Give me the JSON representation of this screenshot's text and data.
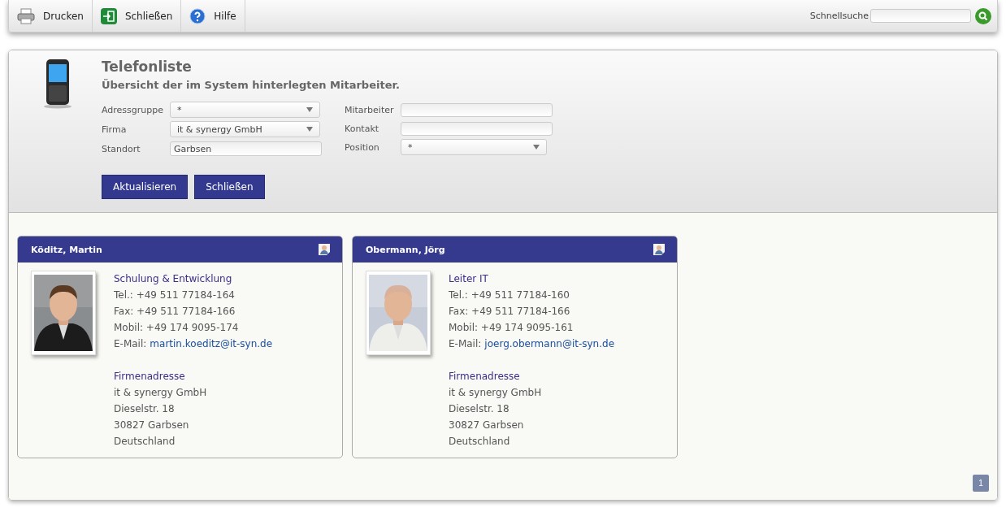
{
  "toolbar": {
    "buttons": [
      {
        "label": "Drucken",
        "kind": "print"
      },
      {
        "label": "Schließen",
        "kind": "close"
      },
      {
        "label": "Hilfe",
        "kind": "help"
      }
    ],
    "search": {
      "label": "Schnellsuche"
    }
  },
  "header": {
    "title": "Telefonliste",
    "subtitle": "Übersicht der im System hinterlegten Mitarbeiter.",
    "columns": [
      [
        {
          "label": "Adressgruppe",
          "kind": "select",
          "value": "*"
        },
        {
          "label": "Firma",
          "kind": "select",
          "value": "it & synergy GmbH"
        },
        {
          "label": "Standort",
          "kind": "input",
          "value": "Garbsen"
        }
      ],
      [
        {
          "label": "Mitarbeiter",
          "kind": "input"
        },
        {
          "label": "Kontakt",
          "kind": "input"
        },
        {
          "label": "Position",
          "kind": "select",
          "value": "*"
        }
      ]
    ],
    "buttons": [
      "Aktualisieren",
      "Schließen"
    ]
  },
  "cards": [
    {
      "name": "Köditz, Martin",
      "position": "Schulung & Entwicklung",
      "phones": [
        "Tel.: +49 511 77184-164",
        "Fax: +49 511 77184-166",
        "Mobil: +49 174 9095-174"
      ],
      "email_label": "E-Mail:",
      "email": "martin.koeditz@it-syn.de",
      "address_title": "Firmenadresse",
      "address": [
        "it & synergy GmbH",
        "Dieselstr. 18",
        "30827 Garbsen",
        "Deutschland"
      ]
    },
    {
      "name": "Obermann, Jörg",
      "position": "Leiter IT",
      "phones": [
        "Tel.: +49 511 77184-160",
        "Fax: +49 511 77184-166",
        "Mobil: +49 174 9095-161"
      ],
      "email_label": "E-Mail:",
      "email": "joerg.obermann@it-syn.de",
      "address_title": "Firmenadresse",
      "address": [
        "it & synergy GmbH",
        "Dieselstr. 18",
        "30827 Garbsen",
        "Deutschland"
      ]
    }
  ],
  "pages": [
    {
      "label": "1",
      "selected": true
    }
  ]
}
